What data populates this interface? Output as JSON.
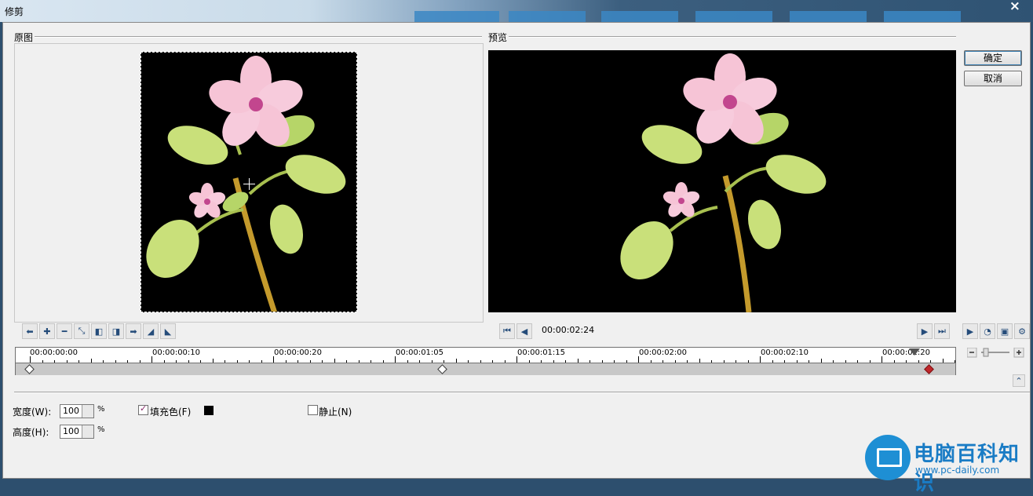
{
  "window": {
    "title": "修剪",
    "close": "×"
  },
  "panels": {
    "original_label": "原图",
    "preview_label": "预览"
  },
  "buttons": {
    "ok": "确定",
    "cancel": "取消"
  },
  "playback": {
    "timecode": "00:00:02:24"
  },
  "timeline": {
    "ticks": [
      "00:00:00:00",
      "00:00:00:10",
      "00:00:00:20",
      "00:00:01:05",
      "00:00:01:15",
      "00:00:02:00",
      "00:00:02:10",
      "00:00:02:20"
    ]
  },
  "fields": {
    "width_label": "宽度(W):",
    "width_value": "100",
    "width_unit": "%",
    "height_label": "高度(H):",
    "height_value": "100",
    "height_unit": "%",
    "fill_label": "填充色(F)",
    "fill_checked": true,
    "fill_color": "#000000",
    "static_label": "静止(N)",
    "static_checked": false
  },
  "toolbar_icons": [
    "arrow-back-icon",
    "plus-icon",
    "minus-icon",
    "fit-icon",
    "prev-keyframe-icon",
    "next-keyframe-icon",
    "arrow-forward-icon",
    "flip-left-icon",
    "flip-right-icon"
  ],
  "watermark": {
    "name": "电脑百科知识",
    "url": "www.pc-daily.com"
  }
}
